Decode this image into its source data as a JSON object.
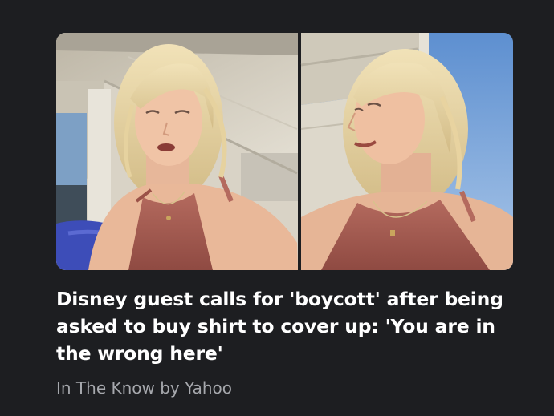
{
  "article": {
    "headline": "Disney guest calls for 'boycott' after being asked to buy shirt to cover up: 'You are in the wrong here'",
    "source": "In The Know by Yahoo"
  }
}
